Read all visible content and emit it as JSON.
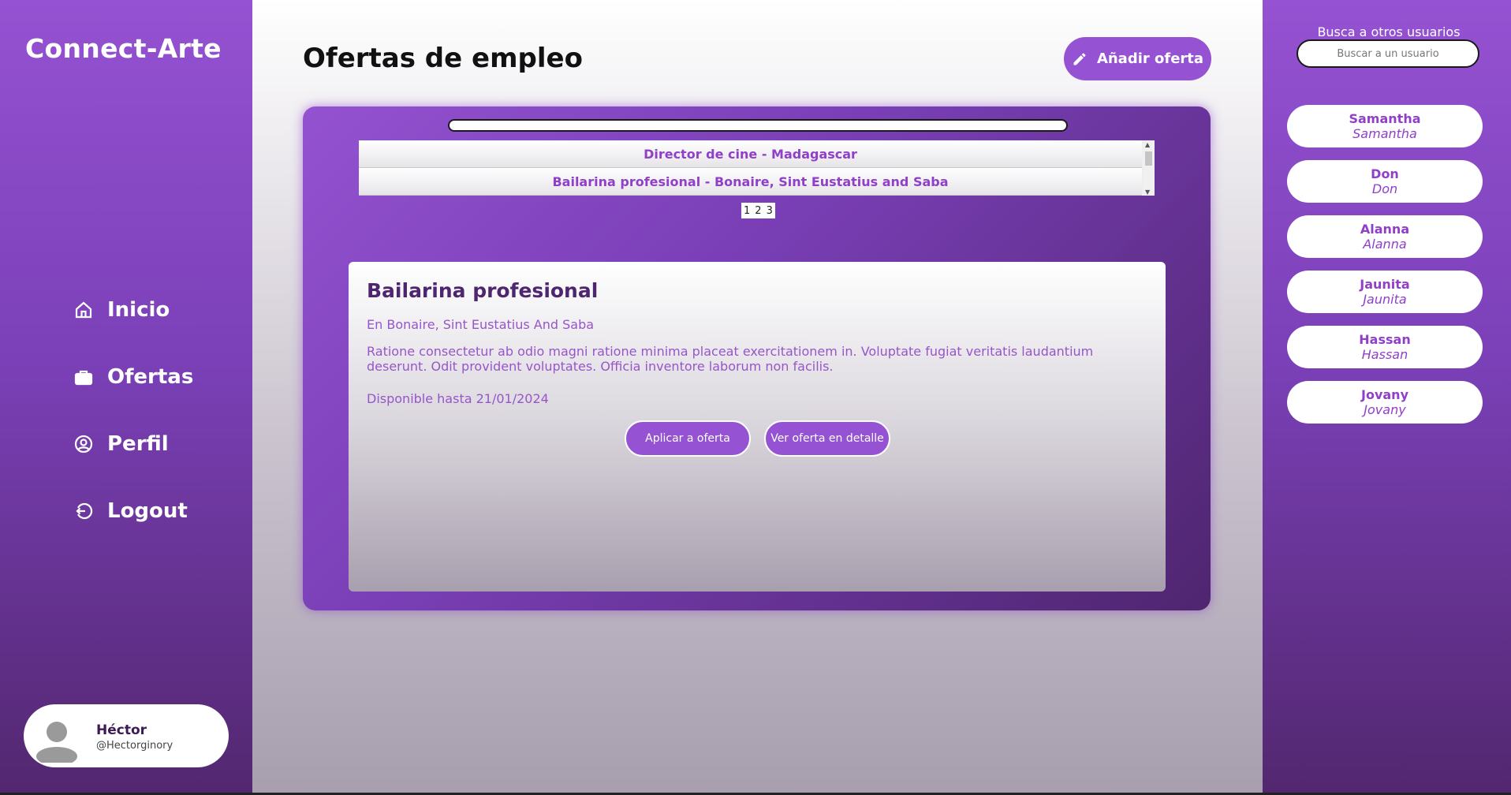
{
  "app": {
    "logo": "Connect-Arte"
  },
  "nav": {
    "items": [
      {
        "label": "Inicio",
        "icon": "home-icon"
      },
      {
        "label": "Ofertas",
        "icon": "briefcase-icon"
      },
      {
        "label": "Perfil",
        "icon": "user-circle-icon"
      },
      {
        "label": "Logout",
        "icon": "logout-icon"
      }
    ]
  },
  "current_user": {
    "name": "Héctor",
    "handle": "@Hectorginory"
  },
  "main": {
    "title": "Ofertas de empleo",
    "add_button": "Añadir oferta",
    "offers": [
      "Director de cine - Madagascar",
      "Bailarina profesional - Bonaire, Sint Eustatius and Saba"
    ],
    "pages": [
      "1",
      "2",
      "3"
    ]
  },
  "detail": {
    "title": "Bailarina profesional",
    "location": "En Bonaire, Sint Eustatius And Saba",
    "description": "Ratione consectetur ab odio magni ratione minima placeat exercitationem in. Voluptate fugiat veritatis laudantium deserunt. Odit provident voluptates. Officia inventore laborum non facilis.",
    "available": "Disponible hasta 21/01/2024",
    "apply_button": "Aplicar a oferta",
    "detail_button": "Ver oferta en detalle"
  },
  "users_panel": {
    "label": "Busca a otros usuarios",
    "search_placeholder": "Buscar a un usuario",
    "users": [
      {
        "name": "Samantha",
        "username": "Samantha"
      },
      {
        "name": "Don",
        "username": "Don"
      },
      {
        "name": "Alanna",
        "username": "Alanna"
      },
      {
        "name": "Jaunita",
        "username": "Jaunita"
      },
      {
        "name": "Hassan",
        "username": "Hassan"
      },
      {
        "name": "Jovany",
        "username": "Jovany"
      }
    ]
  },
  "colors": {
    "accent": "#9552d2",
    "dark": "#52276f",
    "text_purple": "#9656c8"
  }
}
